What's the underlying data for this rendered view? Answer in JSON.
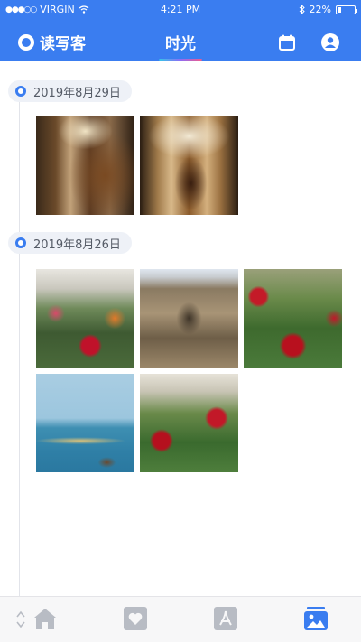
{
  "status_bar": {
    "carrier": "VIRGIN",
    "time": "4:21 PM",
    "battery": "22%",
    "battery_level": 0.22
  },
  "header": {
    "brand": "读写客",
    "title": "时光",
    "bg_color": "#3a7df0"
  },
  "icons": {
    "calendar": "calendar-icon",
    "user": "user-icon",
    "home": "home-icon",
    "favorites": "heart-icon",
    "pdf": "pdf-icon",
    "gallery": "gallery-icon"
  },
  "groups": [
    {
      "date": "2019年8月29日",
      "photos": [
        "church-ceiling",
        "church-altar"
      ]
    },
    {
      "date": "2019年8月26日",
      "photos": [
        "flower-market",
        "church-facade",
        "red-roses",
        "sea-boats",
        "rose-stall"
      ]
    }
  ],
  "active_tab": "gallery",
  "accent_color": "#3a7df0"
}
